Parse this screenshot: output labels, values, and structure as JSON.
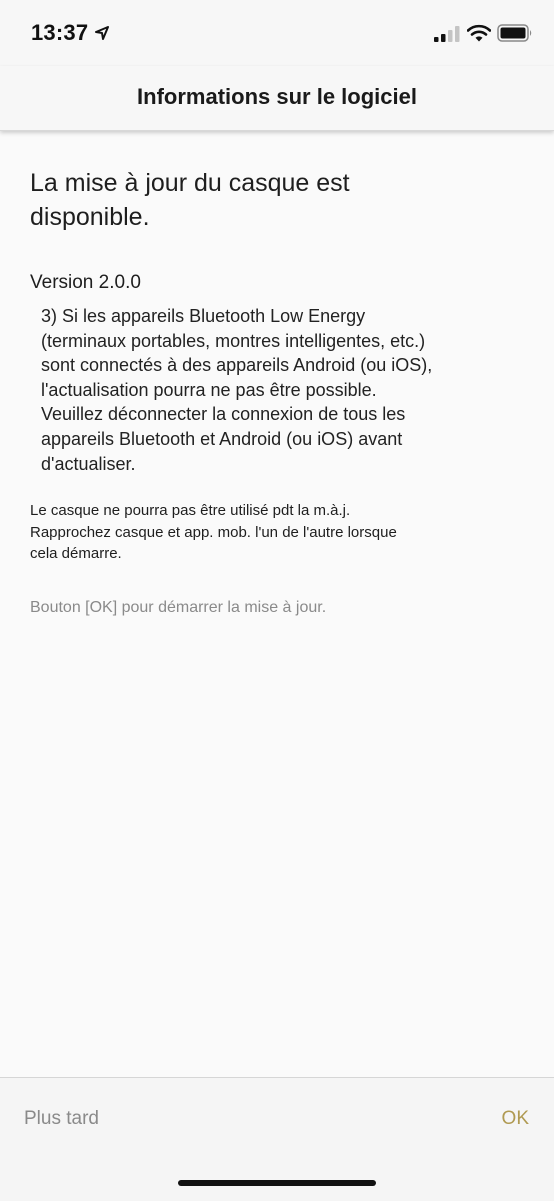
{
  "status_bar": {
    "time": "13:37",
    "icons": [
      "location-arrow-icon",
      "signal-icon",
      "wifi-icon",
      "battery-icon"
    ]
  },
  "nav": {
    "title": "Informations sur le logiciel"
  },
  "content": {
    "heading_lines": [
      "La mise à jour du casque est",
      "disponible."
    ],
    "version": "Version 2.0.0",
    "notes_lines": [
      "3) Si les appareils Bluetooth Low Energy",
      "(terminaux portables, montres intelligentes, etc.)",
      "sont connectés à des appareils Android (ou iOS),",
      "l'actualisation pourra ne pas être possible.",
      "Veuillez déconnecter la connexion de tous les",
      "appareils Bluetooth et Android (ou iOS) avant",
      "d'actualiser."
    ],
    "warning_lines": [
      "Le casque ne pourra pas être utilisé pdt la m.à.j.",
      "Rapprochez casque et app. mob. l'un de l'autre lorsque",
      "cela démarre."
    ],
    "instruction": "Bouton [OK] pour démarrer la mise à jour."
  },
  "footer": {
    "later_label": "Plus tard",
    "ok_label": "OK"
  },
  "colors": {
    "accent": "#b09a52",
    "muted": "#8a8a8a",
    "background": "#fafafa"
  }
}
